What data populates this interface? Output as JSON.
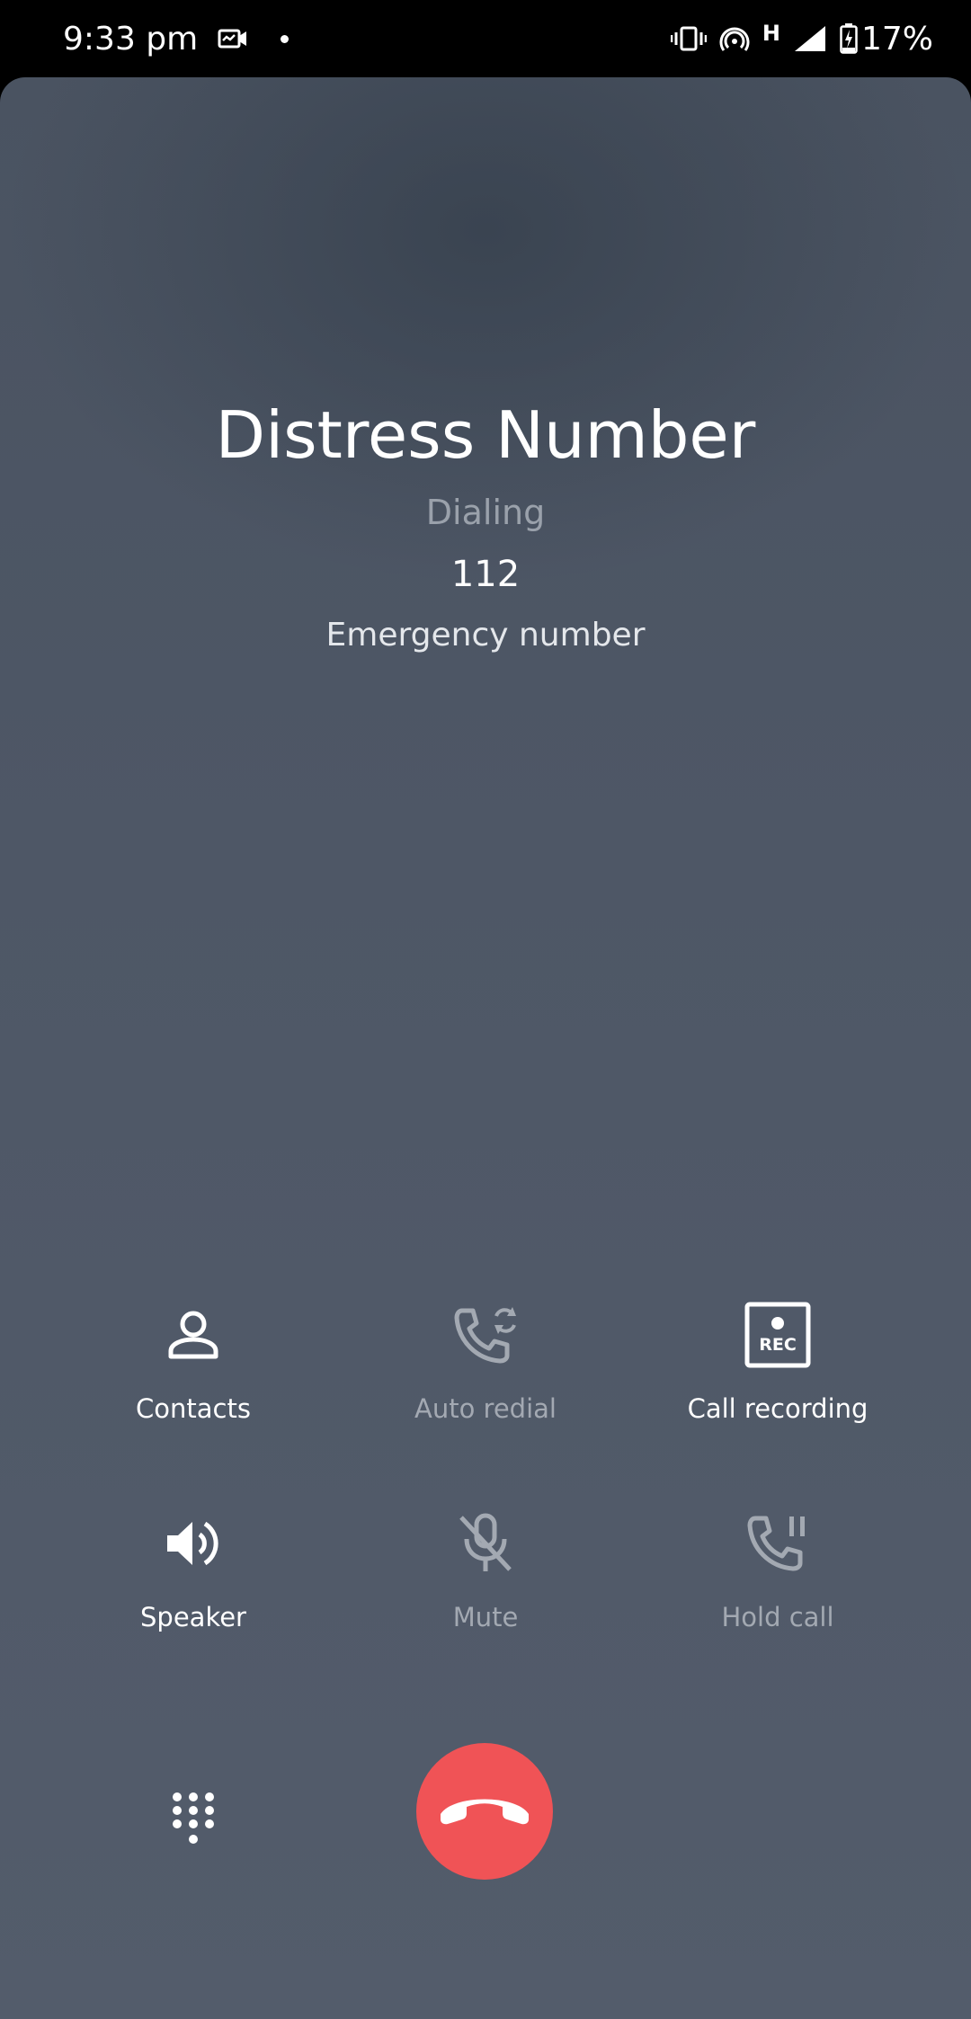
{
  "status_bar": {
    "time": "9:33 pm",
    "network_type": "H",
    "battery_percent": "17%",
    "icons": [
      "video-call-icon",
      "dot-icon",
      "vibrate-icon",
      "hotspot-icon",
      "signal-icon",
      "battery-charging-icon"
    ]
  },
  "call": {
    "name": "Distress Number",
    "status": "Dialing",
    "number": "112",
    "label": "Emergency number"
  },
  "controls": [
    {
      "label": "Contacts",
      "icon": "person-icon",
      "enabled": true
    },
    {
      "label": "Auto redial",
      "icon": "auto-redial-icon",
      "enabled": false
    },
    {
      "label": "Call recording",
      "icon": "rec-icon",
      "enabled": true
    },
    {
      "label": "Speaker",
      "icon": "speaker-icon",
      "enabled": true
    },
    {
      "label": "Mute",
      "icon": "mic-off-icon",
      "enabled": false
    },
    {
      "label": "Hold call",
      "icon": "hold-call-icon",
      "enabled": false
    }
  ],
  "bottom": {
    "dialpad_icon": "dialpad-icon",
    "end_call_icon": "end-call-icon",
    "end_call_color": "#f05356"
  }
}
